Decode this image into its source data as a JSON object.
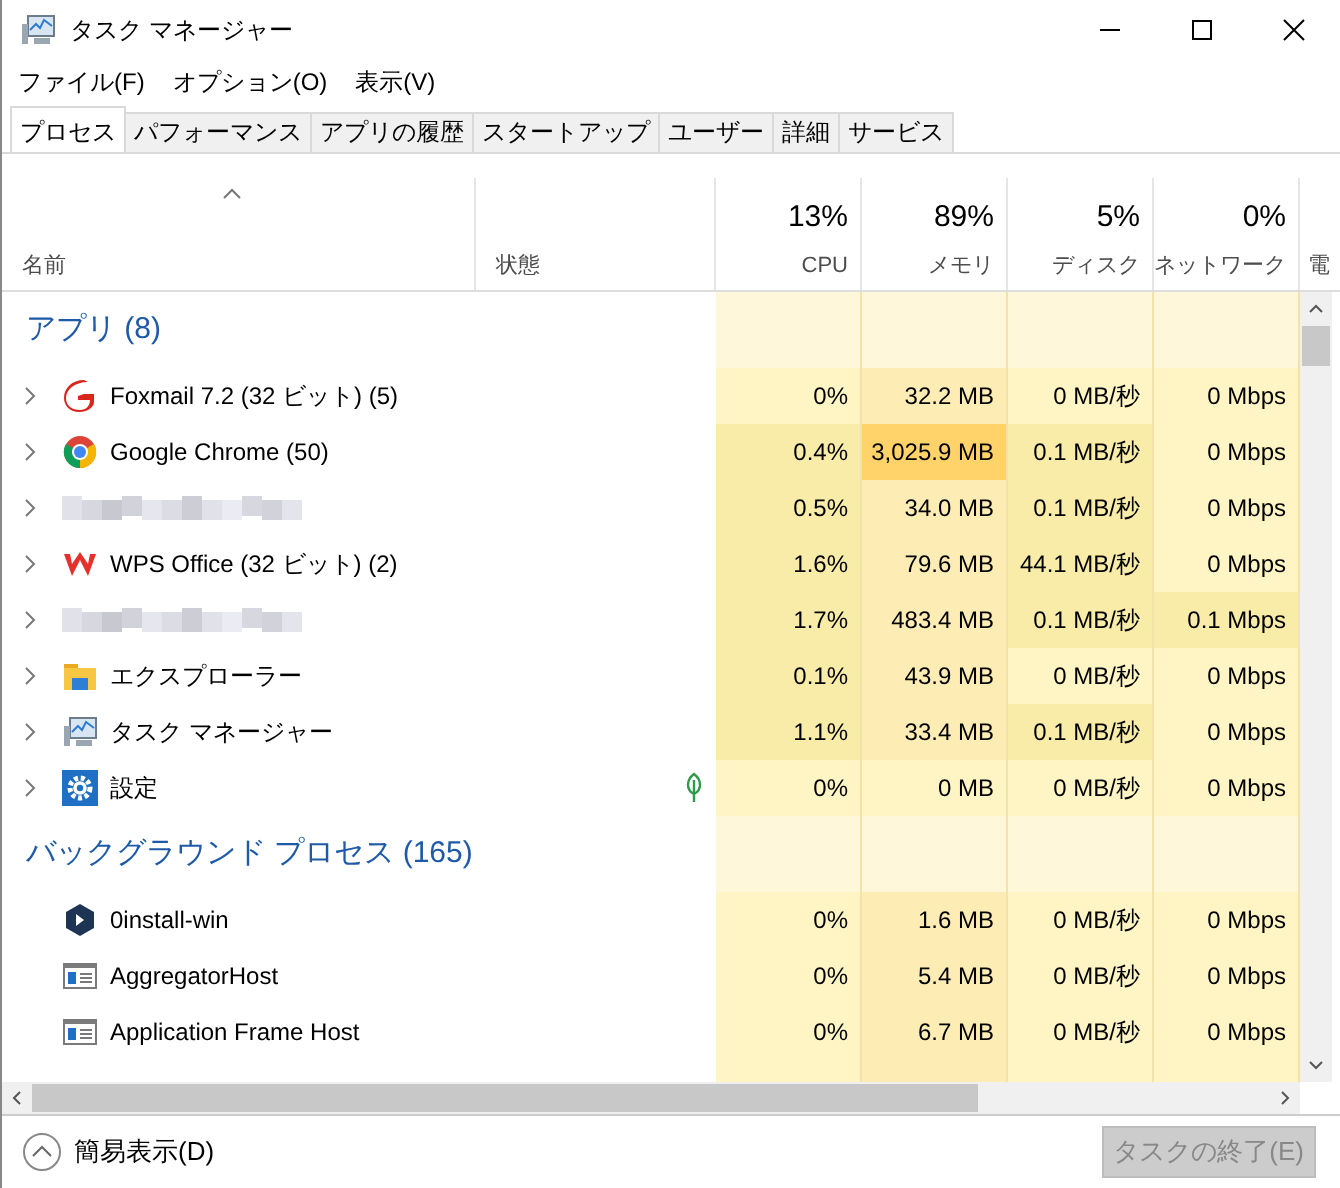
{
  "window": {
    "title": "タスク マネージャー"
  },
  "menu": [
    "ファイル(F)",
    "オプション(O)",
    "表示(V)"
  ],
  "tabs": [
    {
      "label": "プロセス",
      "selected": true
    },
    {
      "label": "パフォーマンス",
      "selected": false
    },
    {
      "label": "アプリの履歴",
      "selected": false
    },
    {
      "label": "スタートアップ",
      "selected": false
    },
    {
      "label": "ユーザー",
      "selected": false
    },
    {
      "label": "詳細",
      "selected": false
    },
    {
      "label": "サービス",
      "selected": false
    }
  ],
  "columns": [
    {
      "label": "名前"
    },
    {
      "label": "状態"
    },
    {
      "total": "13%",
      "label": "CPU"
    },
    {
      "total": "89%",
      "label": "メモリ"
    },
    {
      "total": "5%",
      "label": "ディスク"
    },
    {
      "total": "0%",
      "label": "ネットワーク"
    },
    {
      "label": "電"
    }
  ],
  "groups": [
    {
      "title": "アプリ (8)",
      "rows": [
        {
          "kind": "app",
          "name": "Foxmail 7.2 (32 ビット) (5)",
          "expandable": true,
          "efficiency": false,
          "cells": [
            {
              "text": "0%",
              "color": "#fff4c4"
            },
            {
              "text": "32.2 MB",
              "color": "#fdedb5"
            },
            {
              "text": "0 MB/秒",
              "color": "#fff4c4"
            },
            {
              "text": "0 Mbps",
              "color": "#fff4c4"
            }
          ]
        },
        {
          "kind": "app",
          "name": "Google Chrome (50)",
          "expandable": true,
          "efficiency": false,
          "cells": [
            {
              "text": "0.4%",
              "color": "#f9eba8"
            },
            {
              "text": "3,025.9 MB",
              "color": "#ffd26a"
            },
            {
              "text": "0.1 MB/秒",
              "color": "#f9eba8"
            },
            {
              "text": "0 Mbps",
              "color": "#fff4c4"
            }
          ]
        },
        {
          "kind": "blurred",
          "expandable": true,
          "efficiency": false,
          "cells": [
            {
              "text": "0.5%",
              "color": "#f9eba8"
            },
            {
              "text": "34.0 MB",
              "color": "#fdedb5"
            },
            {
              "text": "0.1 MB/秒",
              "color": "#f9eba8"
            },
            {
              "text": "0 Mbps",
              "color": "#fff4c4"
            }
          ]
        },
        {
          "kind": "app",
          "name": "WPS Office (32 ビット) (2)",
          "expandable": true,
          "efficiency": false,
          "cells": [
            {
              "text": "1.6%",
              "color": "#f9eba8"
            },
            {
              "text": "79.6 MB",
              "color": "#fdedb5"
            },
            {
              "text": "44.1 MB/秒",
              "color": "#f9eba8"
            },
            {
              "text": "0 Mbps",
              "color": "#fff4c4"
            }
          ]
        },
        {
          "kind": "blurred",
          "expandable": true,
          "efficiency": false,
          "cells": [
            {
              "text": "1.7%",
              "color": "#f9eba8"
            },
            {
              "text": "483.4 MB",
              "color": "#fdedb5"
            },
            {
              "text": "0.1 MB/秒",
              "color": "#f9eba8"
            },
            {
              "text": "0.1 Mbps",
              "color": "#f9eba8"
            }
          ]
        },
        {
          "kind": "app",
          "name": "エクスプローラー",
          "expandable": true,
          "efficiency": false,
          "cells": [
            {
              "text": "0.1%",
              "color": "#f9eba8"
            },
            {
              "text": "43.9 MB",
              "color": "#fdedb5"
            },
            {
              "text": "0 MB/秒",
              "color": "#fff4c4"
            },
            {
              "text": "0 Mbps",
              "color": "#fff4c4"
            }
          ]
        },
        {
          "kind": "app",
          "name": "タスク マネージャー",
          "expandable": true,
          "efficiency": false,
          "cells": [
            {
              "text": "1.1%",
              "color": "#f9eba8"
            },
            {
              "text": "33.4 MB",
              "color": "#fdedb5"
            },
            {
              "text": "0.1 MB/秒",
              "color": "#f9eba8"
            },
            {
              "text": "0 Mbps",
              "color": "#fff4c4"
            }
          ]
        },
        {
          "kind": "app",
          "name": "設定",
          "expandable": true,
          "efficiency": true,
          "cells": [
            {
              "text": "0%",
              "color": "#fff4c4"
            },
            {
              "text": "0 MB",
              "color": "#fff4c4"
            },
            {
              "text": "0 MB/秒",
              "color": "#fff4c4"
            },
            {
              "text": "0 Mbps",
              "color": "#fff4c4"
            }
          ]
        }
      ]
    },
    {
      "title": "バックグラウンド プロセス (165)",
      "rows": [
        {
          "kind": "app",
          "name": "0install-win",
          "expandable": false,
          "efficiency": false,
          "cells": [
            {
              "text": "0%",
              "color": "#fff4c4"
            },
            {
              "text": "1.6 MB",
              "color": "#fdedb5"
            },
            {
              "text": "0 MB/秒",
              "color": "#fff4c4"
            },
            {
              "text": "0 Mbps",
              "color": "#fff4c4"
            }
          ]
        },
        {
          "kind": "app",
          "name": "AggregatorHost",
          "expandable": false,
          "efficiency": false,
          "cells": [
            {
              "text": "0%",
              "color": "#fff4c4"
            },
            {
              "text": "5.4 MB",
              "color": "#fdedb5"
            },
            {
              "text": "0 MB/秒",
              "color": "#fff4c4"
            },
            {
              "text": "0 Mbps",
              "color": "#fff4c4"
            }
          ]
        },
        {
          "kind": "app",
          "name": "Application Frame Host",
          "expandable": false,
          "efficiency": false,
          "cells": [
            {
              "text": "0%",
              "color": "#fff4c4"
            },
            {
              "text": "6.7 MB",
              "color": "#fdedb5"
            },
            {
              "text": "0 MB/秒",
              "color": "#fff4c4"
            },
            {
              "text": "0 Mbps",
              "color": "#fff4c4"
            }
          ]
        }
      ]
    }
  ],
  "footer": {
    "toggle": "簡易表示(D)",
    "end_task": {
      "label": "タスクの終了(E)",
      "disabled": true
    }
  }
}
